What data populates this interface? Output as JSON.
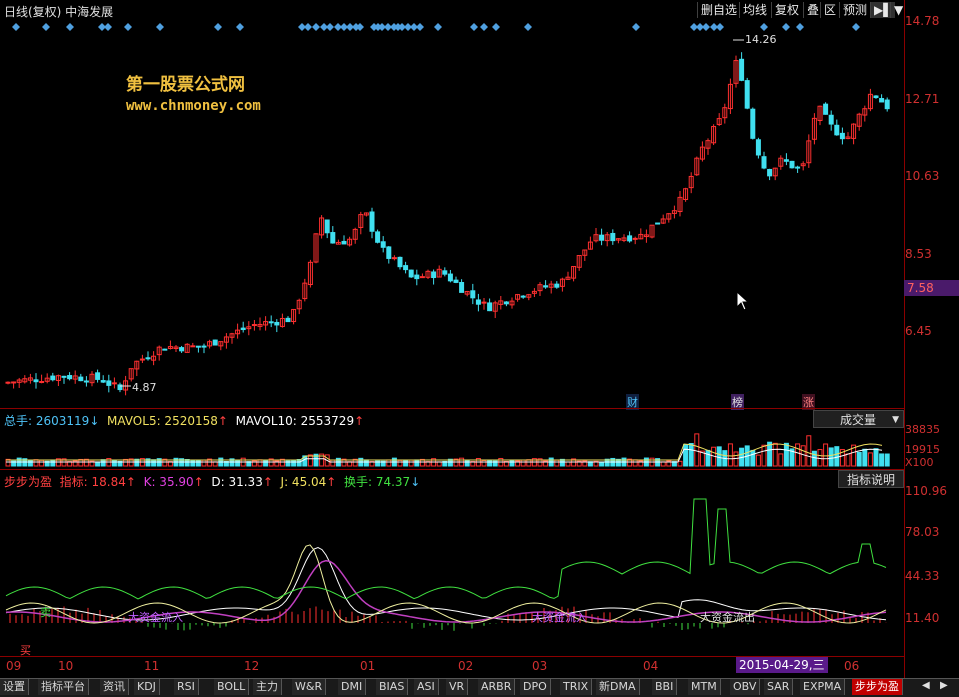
{
  "topbar": {
    "title": "日线(复权)  中海发展",
    "buttons": [
      "删自选",
      "均线",
      "复权",
      "叠",
      "区",
      "预测",
      "▶▌",
      "▼"
    ]
  },
  "watermark": {
    "line1": "第一股票公式网",
    "line2": "www.chnmoney.com"
  },
  "price_axis": {
    "labels": [
      "14.78",
      "12.71",
      "10.63",
      "8.53",
      "6.45"
    ],
    "current": "7.58"
  },
  "annotations": {
    "high": "14.26",
    "low": "4.87",
    "cai": "财",
    "bang": "榜",
    "zhang": "涨"
  },
  "volume": {
    "header": [
      {
        "text": "总手: 2603119",
        "color": "#4fc3f7"
      },
      {
        "text": "↓",
        "color": "#4fc3f7"
      },
      {
        "text": "MAVOL5: 2520158",
        "color": "#f0e060"
      },
      {
        "text": "↑",
        "color": "#ff4040"
      },
      {
        "text": "MAVOL10: 2553729",
        "color": "#ffffff"
      },
      {
        "text": "↑",
        "color": "#ff4040"
      }
    ],
    "selector": "成交量",
    "axis": [
      "38835",
      "19915",
      "X100"
    ]
  },
  "indicator": {
    "header": [
      {
        "text": "步步为盈",
        "color": "#ff4040"
      },
      {
        "text": "指标: 18.84",
        "color": "#ff4040"
      },
      {
        "text": "↑",
        "color": "#ff4040"
      },
      {
        "text": "K: 35.90",
        "color": "#e040e0"
      },
      {
        "text": "↑",
        "color": "#ff4040"
      },
      {
        "text": "D: 31.33",
        "color": "#ffffff"
      },
      {
        "text": "↑",
        "color": "#ff4040"
      },
      {
        "text": "J: 45.04",
        "color": "#f0e060"
      },
      {
        "text": "↑",
        "color": "#ff4040"
      },
      {
        "text": "换手: 74.37",
        "color": "#40e040"
      },
      {
        "text": "↓",
        "color": "#4fc3f7"
      }
    ],
    "help_button": "指标说明",
    "axis": [
      "110.96",
      "78.03",
      "44.33",
      "11.40"
    ],
    "signal_labels": {
      "sell": "卖",
      "buy": "买",
      "inflow": "大资金流入",
      "outflow": "大资金流出",
      "inflow2": "大资金流入"
    }
  },
  "x_axis": [
    "09",
    "10",
    "11",
    "12",
    "01",
    "02",
    "03",
    "04",
    "06"
  ],
  "cursor_date": "2015-04-29,三",
  "tabs": [
    "设置",
    "指标平台",
    "资讯",
    "KDJ",
    "RSI",
    "BOLL",
    "主力",
    "W&R",
    "DMI",
    "BIAS",
    "ASI",
    "VR",
    "ARBR",
    "DPO",
    "TRIX",
    "新DMA",
    "BBI",
    "MTM",
    "OBV",
    "SAR",
    "EXPMA",
    "步步为盈"
  ],
  "active_tab": "步步为盈",
  "colors": {
    "up": "#ff3030",
    "down": "#40e0f0",
    "axis": "#8b0000",
    "diamond": "#4fa0e0"
  }
}
